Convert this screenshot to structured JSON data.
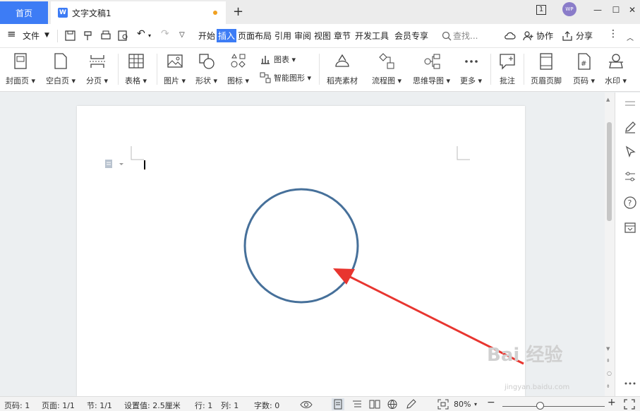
{
  "tabs": {
    "home": "首页",
    "doc_title": "文字文稿1",
    "doc_icon": "W",
    "new_tab": "+",
    "page_count_badge": "1",
    "avatar": "WP"
  },
  "window": {
    "minimize": "—",
    "maximize": "☐",
    "close": "✕"
  },
  "menu": {
    "hamburger": "≡",
    "file": "文件",
    "tabs": [
      "开始",
      "插入",
      "页面布局",
      "引用",
      "审阅",
      "视图",
      "章节",
      "开发工具",
      "会员专享"
    ],
    "active_tab": "插入",
    "search": "查找...",
    "collab": "协作",
    "share": "分享",
    "more": "⋮"
  },
  "ribbon": {
    "cover": "封面页",
    "blank": "空白页",
    "page_break": "分页",
    "table": "表格",
    "picture": "图片",
    "shape": "形状",
    "icon": "图标",
    "chart": "图表",
    "smart_shape": "智能图形",
    "material": "稻壳素材",
    "flowchart": "流程图",
    "mindmap": "思维导图",
    "more": "更多",
    "comment": "批注",
    "header_footer": "页眉页脚",
    "page_num": "页码",
    "watermark": "水印"
  },
  "status": {
    "page_no": "页码: 1",
    "pages": "页面: 1/1",
    "section": "节: 1/1",
    "setting": "设置值: 2.5厘米",
    "row": "行: 1",
    "col": "列: 1",
    "words": "字数: 0",
    "zoom": "80%"
  },
  "watermark_text": {
    "main": "Bai 经验",
    "sub": "jingyan.baidu.com"
  },
  "colors": {
    "accent": "#3d7cf5",
    "circle": "#46709a",
    "arrow": "#e8352f"
  }
}
